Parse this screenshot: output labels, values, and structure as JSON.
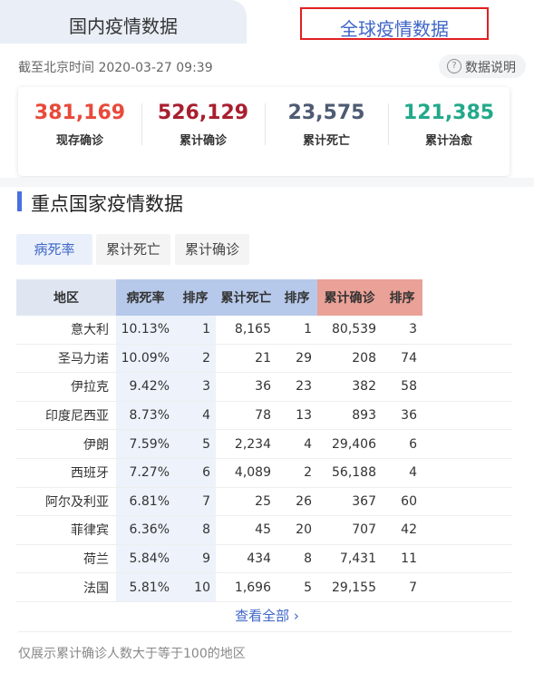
{
  "tabs": {
    "domestic": "国内疫情数据",
    "global": "全球疫情数据"
  },
  "timestamp": "截至北京时间 2020-03-27 09:39",
  "explain": "数据说明",
  "stats": [
    {
      "value": "381,169",
      "label": "现存确诊",
      "color": "#e84a3a"
    },
    {
      "value": "526,129",
      "label": "累计确诊",
      "color": "#a91e2f"
    },
    {
      "value": "23,575",
      "label": "累计死亡",
      "color": "#4e5b73"
    },
    {
      "value": "121,385",
      "label": "累计治愈",
      "color": "#22a98a"
    }
  ],
  "section_title": "重点国家疫情数据",
  "filters": [
    "病死率",
    "累计死亡",
    "累计确诊"
  ],
  "table": {
    "headers": [
      "地区",
      "病死率",
      "排序",
      "累计死亡",
      "排序",
      "累计确诊",
      "排序"
    ],
    "rows": [
      [
        "意大利",
        "10.13%",
        "1",
        "8,165",
        "1",
        "80,539",
        "3"
      ],
      [
        "圣马力诺",
        "10.09%",
        "2",
        "21",
        "29",
        "208",
        "74"
      ],
      [
        "伊拉克",
        "9.42%",
        "3",
        "36",
        "23",
        "382",
        "58"
      ],
      [
        "印度尼西亚",
        "8.73%",
        "4",
        "78",
        "13",
        "893",
        "36"
      ],
      [
        "伊朗",
        "7.59%",
        "5",
        "2,234",
        "4",
        "29,406",
        "6"
      ],
      [
        "西班牙",
        "7.27%",
        "6",
        "4,089",
        "2",
        "56,188",
        "4"
      ],
      [
        "阿尔及利亚",
        "6.81%",
        "7",
        "25",
        "26",
        "367",
        "60"
      ],
      [
        "菲律宾",
        "6.36%",
        "8",
        "45",
        "20",
        "707",
        "42"
      ],
      [
        "荷兰",
        "5.84%",
        "9",
        "434",
        "8",
        "7,431",
        "11"
      ],
      [
        "法国",
        "5.81%",
        "10",
        "1,696",
        "5",
        "29,155",
        "7"
      ]
    ]
  },
  "view_all": "查看全部 ›",
  "footer_note": "仅展示累计确诊人数大于等于100的地区"
}
